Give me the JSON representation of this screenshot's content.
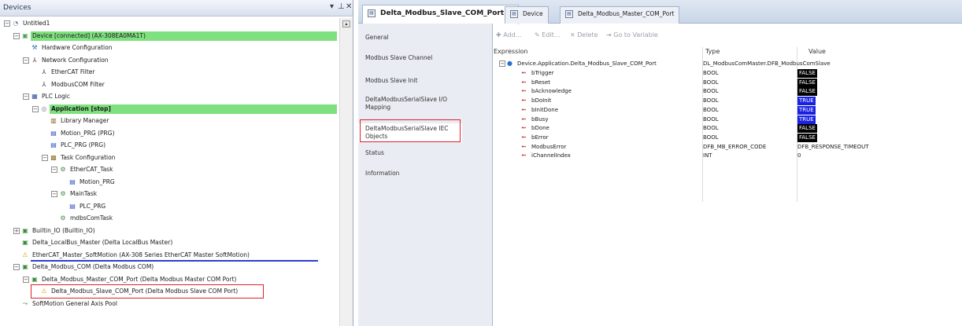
{
  "devices_pane": {
    "title": "Devices",
    "pin_icon": "pin-icon",
    "close_icon": "close-icon",
    "tree": [
      {
        "label": "Untitled1",
        "level": 0,
        "expander": "-",
        "icon": "project-icon",
        "icon_glyph": "◔",
        "highlight": ""
      },
      {
        "label": "Device [connected] (AX-308EA0MA1T)",
        "level": 1,
        "expander": "-",
        "icon": "device-connected-icon",
        "icon_glyph": "▣",
        "highlight": "green"
      },
      {
        "label": "Hardware Configuration",
        "level": 2,
        "expander": "",
        "icon": "hardware-config-icon",
        "icon_glyph": "⚒",
        "highlight": ""
      },
      {
        "label": "Network Configuration",
        "level": 2,
        "expander": "-",
        "icon": "network-icon",
        "icon_glyph": "⅄",
        "highlight": ""
      },
      {
        "label": "EtherCAT Filter",
        "level": 3,
        "expander": "",
        "icon": "network-filter-icon",
        "icon_glyph": "⅄",
        "highlight": ""
      },
      {
        "label": "ModbusCOM Filter",
        "level": 3,
        "expander": "",
        "icon": "network-filter-icon",
        "icon_glyph": "⅄",
        "highlight": ""
      },
      {
        "label": "PLC Logic",
        "level": 2,
        "expander": "-",
        "icon": "plc-logic-icon",
        "icon_glyph": "▦",
        "highlight": ""
      },
      {
        "label": "Application [stop]",
        "level": 3,
        "expander": "-",
        "icon": "application-icon",
        "icon_glyph": "◎",
        "highlight": "green",
        "bold": true
      },
      {
        "label": "Library Manager",
        "level": 4,
        "expander": "",
        "icon": "library-manager-icon",
        "icon_glyph": "▥",
        "highlight": ""
      },
      {
        "label": "Motion_PRG (PRG)",
        "level": 4,
        "expander": "",
        "icon": "program-icon",
        "icon_glyph": "▤",
        "highlight": ""
      },
      {
        "label": "PLC_PRG (PRG)",
        "level": 4,
        "expander": "",
        "icon": "program-icon",
        "icon_glyph": "▤",
        "highlight": ""
      },
      {
        "label": "Task Configuration",
        "level": 4,
        "expander": "-",
        "icon": "task-config-icon",
        "icon_glyph": "▩",
        "highlight": ""
      },
      {
        "label": "EtherCAT_Task",
        "level": 5,
        "expander": "-",
        "icon": "task-icon",
        "icon_glyph": "⚙",
        "highlight": ""
      },
      {
        "label": "Motion_PRG",
        "level": 6,
        "expander": "",
        "icon": "program-call-icon",
        "icon_glyph": "▤",
        "highlight": ""
      },
      {
        "label": "MainTask",
        "level": 5,
        "expander": "-",
        "icon": "task-icon",
        "icon_glyph": "⚙",
        "highlight": ""
      },
      {
        "label": "PLC_PRG",
        "level": 6,
        "expander": "",
        "icon": "program-call-icon",
        "icon_glyph": "▤",
        "highlight": ""
      },
      {
        "label": "mdbsComTask",
        "level": 5,
        "expander": "",
        "icon": "task-icon",
        "icon_glyph": "⚙",
        "highlight": ""
      },
      {
        "label": "Builtin_IO (Builtin_IO)",
        "level": 1,
        "expander": "+",
        "icon": "io-device-icon",
        "icon_glyph": "▣",
        "highlight": ""
      },
      {
        "label": "Delta_LocalBus_Master (Delta LocalBus Master)",
        "level": 1,
        "expander": "",
        "icon": "bus-master-icon",
        "icon_glyph": "▣",
        "highlight": ""
      },
      {
        "label": "EtherCAT_Master_SoftMotion (AX-308 Series EtherCAT Master SoftMotion)",
        "level": 1,
        "expander": "",
        "icon": "warning-icon",
        "icon_glyph": "⚠",
        "highlight": "",
        "underline": true
      },
      {
        "label": "Delta_Modbus_COM (Delta Modbus COM)",
        "level": 1,
        "expander": "-",
        "icon": "com-device-icon",
        "icon_glyph": "▣",
        "highlight": ""
      },
      {
        "label": "Delta_Modbus_Master_COM_Port (Delta Modbus Master COM Port)",
        "level": 2,
        "expander": "-",
        "icon": "com-port-icon",
        "icon_glyph": "▣",
        "highlight": ""
      },
      {
        "label": "Delta_Modbus_Slave_COM_Port (Delta Modbus Slave COM Port)",
        "level": 3,
        "expander": "",
        "icon": "warning-icon",
        "icon_glyph": "⚠",
        "highlight": "",
        "boxed": true
      },
      {
        "label": "SoftMotion General Axis Pool",
        "level": 1,
        "expander": "",
        "icon": "axis-pool-icon",
        "icon_glyph": "⤳",
        "highlight": ""
      }
    ]
  },
  "tabs": [
    {
      "label": "Delta_Modbus_Slave_COM_Port",
      "active": true,
      "close": "x"
    },
    {
      "label": "Device",
      "active": false
    },
    {
      "label": "Delta_Modbus_Master_COM_Port",
      "active": false
    }
  ],
  "side_tabs": [
    {
      "label": "General"
    },
    {
      "label": "Modbus Slave Channel"
    },
    {
      "label": "Modbus Slave Init"
    },
    {
      "label": "DeltaModbusSerialSlave I/O Mapping"
    },
    {
      "label": "DeltaModbusSerialSlave IEC Objects",
      "selected": true
    },
    {
      "label": "Status"
    },
    {
      "label": "Information"
    }
  ],
  "toolbar": {
    "add": "Add...",
    "edit": "Edit...",
    "delete": "Delete",
    "goto": "Go to Variable"
  },
  "grid": {
    "headers": [
      "Expression",
      "Type",
      "Value"
    ],
    "root": {
      "expression": "Device.Application.Delta_Modbus_Slave_COM_Port",
      "type": "DL_ModbusComMaster.DFB_ModbusComSlave",
      "value": ""
    },
    "rows": [
      {
        "expression": "bTrigger",
        "type": "BOOL",
        "value": "FALSE",
        "state": "false"
      },
      {
        "expression": "bReset",
        "type": "BOOL",
        "value": "FALSE",
        "state": "false"
      },
      {
        "expression": "bAcknowledge",
        "type": "BOOL",
        "value": "FALSE",
        "state": "false"
      },
      {
        "expression": "bDoInit",
        "type": "BOOL",
        "value": "TRUE",
        "state": "true"
      },
      {
        "expression": "bInitDone",
        "type": "BOOL",
        "value": "TRUE",
        "state": "true"
      },
      {
        "expression": "bBusy",
        "type": "BOOL",
        "value": "TRUE",
        "state": "true"
      },
      {
        "expression": "bDone",
        "type": "BOOL",
        "value": "FALSE",
        "state": "false"
      },
      {
        "expression": "bError",
        "type": "BOOL",
        "value": "FALSE",
        "state": "false"
      },
      {
        "expression": "ModbusError",
        "type": "DFB_MB_ERROR_CODE",
        "value": "DFB_RESPONSE_TIMEOUT",
        "state": "text"
      },
      {
        "expression": "iChannelIndex",
        "type": "INT",
        "value": "0",
        "state": "text"
      }
    ]
  },
  "colors": {
    "highlight_green": "#7fe07f",
    "true_badge": "#1a22e0",
    "false_badge": "#000000",
    "selection_box": "#e01f2b",
    "link_underline": "#2b3fd4"
  }
}
